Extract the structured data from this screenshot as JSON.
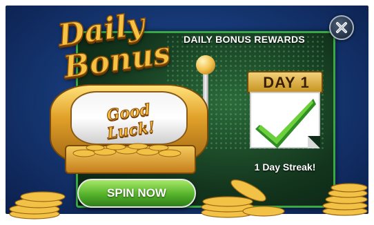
{
  "popup": {
    "title_line1": "Daily",
    "title_line2": "Bonus",
    "header": "DAILY BONUS REWARDS",
    "slot_text": "Good Luck!",
    "calendar_day": "DAY 1",
    "streak_text": "1 Day Streak!",
    "spin_button": "SPIN NOW"
  },
  "icons": {
    "close": "close-icon",
    "check": "check-icon",
    "coins": "gold-coins"
  },
  "colors": {
    "accent_gold": "#f6c244",
    "panel_green": "#39a845",
    "button_green": "#55b22a",
    "background_blue": "#173a78"
  }
}
